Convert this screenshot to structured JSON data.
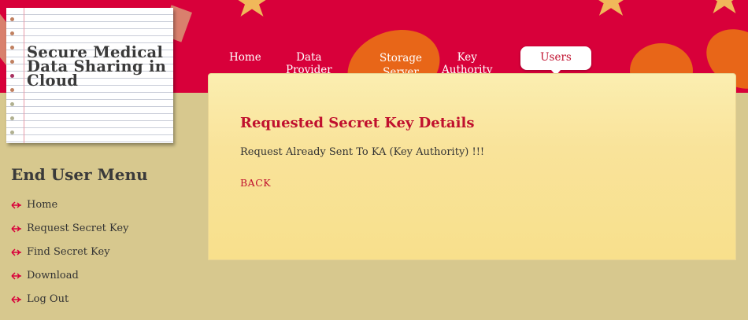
{
  "app": {
    "title": "Secure Medical Data Sharing in Cloud"
  },
  "nav": {
    "items": [
      {
        "label": "Home"
      },
      {
        "label": "Data Provider"
      },
      {
        "label": "Storage Server"
      },
      {
        "label": "Key Authority"
      },
      {
        "label": "Users",
        "active": true
      }
    ]
  },
  "sidebar": {
    "title": "End User Menu",
    "items": [
      {
        "label": "Home"
      },
      {
        "label": "Request Secret Key"
      },
      {
        "label": "Find Secret Key"
      },
      {
        "label": "Download"
      },
      {
        "label": "Log Out"
      }
    ]
  },
  "main": {
    "heading": "Requested Secret Key Details",
    "message": "Request Already Sent To KA (Key Authority) !!!",
    "back_label": "BACK"
  },
  "colors": {
    "header": "#d8003a",
    "accent": "#c0102e",
    "background": "#d7c88e",
    "panel": "#f9e39a"
  }
}
